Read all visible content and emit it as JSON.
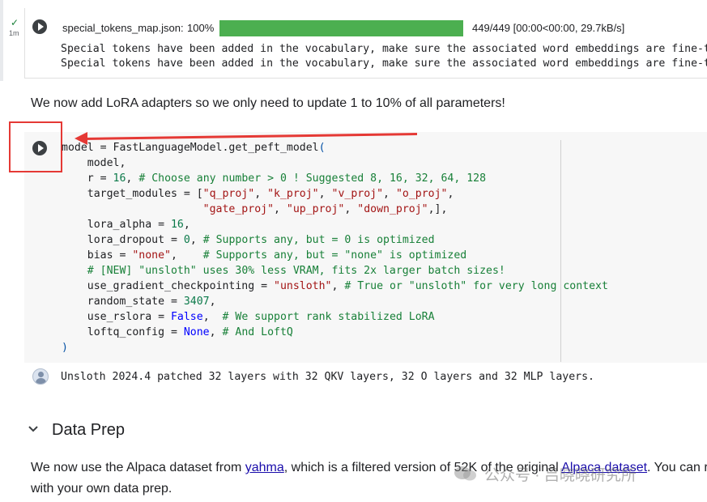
{
  "top_output": {
    "exec_check": "✓",
    "exec_time": "1m",
    "progress": {
      "label": "special_tokens_map.json:",
      "percent_text": "100%",
      "fraction": 1.0,
      "stats": "449/449  [00:00<00:00,  29.7kB/s]"
    },
    "lines": [
      "Special tokens have been added in the vocabulary, make sure the associated word embeddings are fine-tune",
      "Special tokens have been added in the vocabulary, make sure the associated word embeddings are fine-tune"
    ]
  },
  "text_cell_1": "We now add LoRA adapters so we only need to update 1 to 10% of all parameters!",
  "code_cell": {
    "lines": [
      [
        {
          "t": "model = FastLanguageModel.get_peft_model",
          "c": ""
        },
        {
          "t": "(",
          "c": "par"
        }
      ],
      [
        {
          "t": "    model,",
          "c": ""
        }
      ],
      [
        {
          "t": "    r = ",
          "c": ""
        },
        {
          "t": "16",
          "c": "num"
        },
        {
          "t": ", ",
          "c": ""
        },
        {
          "t": "# Choose any number > 0 ! Suggested 8, 16, 32, 64, 128",
          "c": "com"
        }
      ],
      [
        {
          "t": "    target_modules = [",
          "c": ""
        },
        {
          "t": "\"q_proj\"",
          "c": "str"
        },
        {
          "t": ", ",
          "c": ""
        },
        {
          "t": "\"k_proj\"",
          "c": "str"
        },
        {
          "t": ", ",
          "c": ""
        },
        {
          "t": "\"v_proj\"",
          "c": "str"
        },
        {
          "t": ", ",
          "c": ""
        },
        {
          "t": "\"o_proj\"",
          "c": "str"
        },
        {
          "t": ",",
          "c": ""
        }
      ],
      [
        {
          "t": "                      ",
          "c": ""
        },
        {
          "t": "\"gate_proj\"",
          "c": "str"
        },
        {
          "t": ", ",
          "c": ""
        },
        {
          "t": "\"up_proj\"",
          "c": "str"
        },
        {
          "t": ", ",
          "c": ""
        },
        {
          "t": "\"down_proj\"",
          "c": "str"
        },
        {
          "t": ",],",
          "c": ""
        }
      ],
      [
        {
          "t": "    lora_alpha = ",
          "c": ""
        },
        {
          "t": "16",
          "c": "num"
        },
        {
          "t": ",",
          "c": ""
        }
      ],
      [
        {
          "t": "    lora_dropout = ",
          "c": ""
        },
        {
          "t": "0",
          "c": "num"
        },
        {
          "t": ", ",
          "c": ""
        },
        {
          "t": "# Supports any, but = 0 is optimized",
          "c": "com"
        }
      ],
      [
        {
          "t": "    bias = ",
          "c": ""
        },
        {
          "t": "\"none\"",
          "c": "str"
        },
        {
          "t": ",    ",
          "c": ""
        },
        {
          "t": "# Supports any, but = \"none\" is optimized",
          "c": "com"
        }
      ],
      [
        {
          "t": "    ",
          "c": ""
        },
        {
          "t": "# [NEW] \"unsloth\" uses 30% less VRAM, fits 2x larger batch sizes!",
          "c": "com"
        }
      ],
      [
        {
          "t": "    use_gradient_checkpointing = ",
          "c": ""
        },
        {
          "t": "\"unsloth\"",
          "c": "str"
        },
        {
          "t": ", ",
          "c": ""
        },
        {
          "t": "# True or \"unsloth\" for very long context",
          "c": "com"
        }
      ],
      [
        {
          "t": "    random_state = ",
          "c": ""
        },
        {
          "t": "3407",
          "c": "num"
        },
        {
          "t": ",",
          "c": ""
        }
      ],
      [
        {
          "t": "    use_rslora = ",
          "c": ""
        },
        {
          "t": "False",
          "c": "kw"
        },
        {
          "t": ",  ",
          "c": ""
        },
        {
          "t": "# We support rank stabilized LoRA",
          "c": "com"
        }
      ],
      [
        {
          "t": "    loftq_config = ",
          "c": ""
        },
        {
          "t": "None",
          "c": "kw"
        },
        {
          "t": ", ",
          "c": ""
        },
        {
          "t": "# And LoftQ",
          "c": "com"
        }
      ],
      [
        {
          "t": ")",
          "c": "par"
        }
      ]
    ],
    "output": "Unsloth 2024.4 patched 32 layers with 32 QKV layers, 32 O layers and 32 MLP layers."
  },
  "section": {
    "title": "Data Prep"
  },
  "text_cell_2": {
    "line1_a": "We now use the Alpaca dataset from ",
    "link1": "yahma",
    "line1_b": ", which is a filtered version of 52K of the original ",
    "link2": "Alpaca dataset",
    "line1_c": ". You can r",
    "line2": "with your own data prep."
  },
  "watermark": "公众号 · 吕晓晓研究所",
  "colors": {
    "progress_fill": "#4caf50",
    "annotation_red": "#e53935"
  }
}
